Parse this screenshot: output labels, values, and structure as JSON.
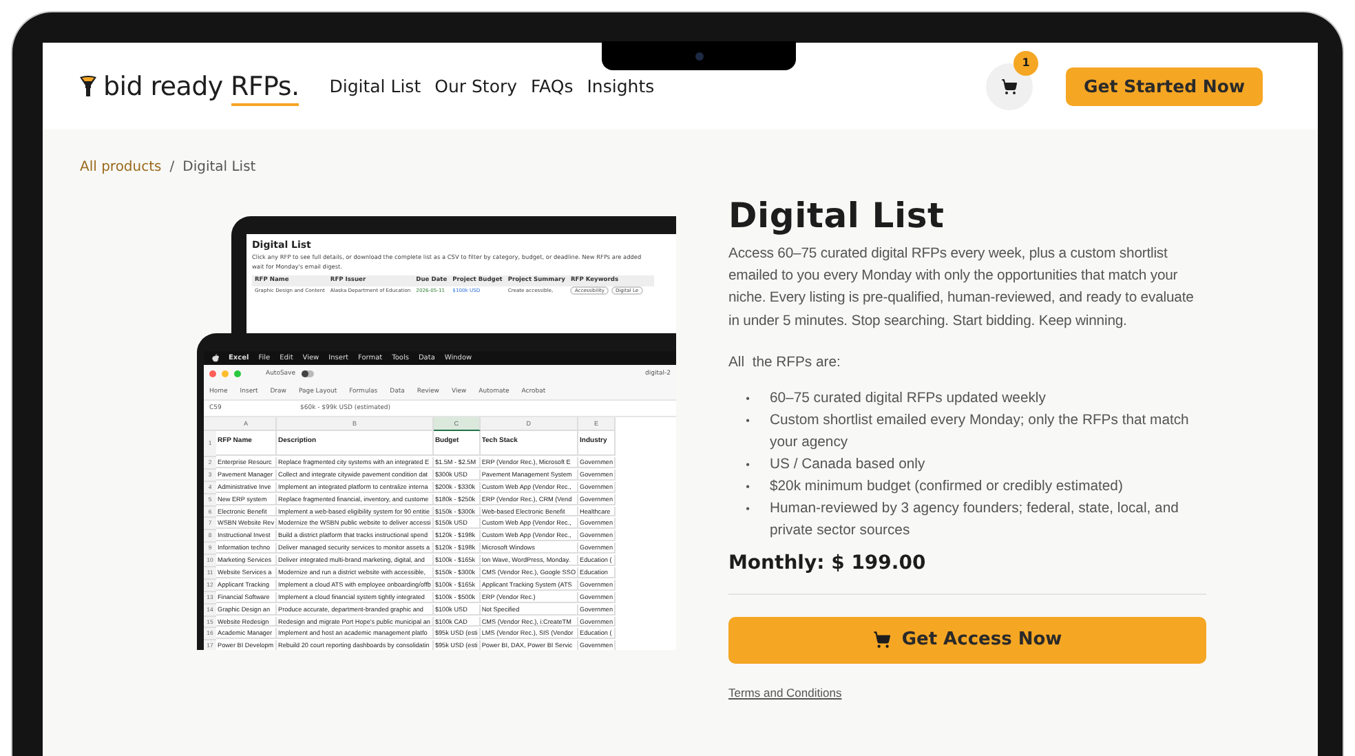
{
  "header": {
    "logo": {
      "text": "bid ready",
      "underlined": "RFPs."
    },
    "nav": [
      {
        "label": "Digital List"
      },
      {
        "label": "Our Story"
      },
      {
        "label": "FAQs"
      },
      {
        "label": "Insights"
      }
    ],
    "cart": {
      "count": "1"
    },
    "cta": "Get Started Now"
  },
  "breadcrumb": {
    "items": [
      {
        "label": "All products",
        "kind": "link"
      },
      {
        "label": "Digital List",
        "kind": "current"
      }
    ],
    "separator": "/"
  },
  "product_image": {
    "back_screen": {
      "title": "Digital List",
      "description": [
        "Click any RFP to see full details, or download the complete list as a CSV to filter by category, budget, or deadline. New RFPs are added",
        "wait for Monday's email digest."
      ],
      "columns": [
        "RFP Name",
        "RFP Issuer",
        "Due Date",
        "Project Budget",
        "Project Summary",
        "RFP Keywords"
      ],
      "row": [
        "Graphic Design and Content",
        "Alaska Department of Education",
        "2026-05-11",
        "$100k USD",
        "Create accessible,"
      ],
      "tags": [
        "Accessibility",
        "Digital Le"
      ]
    },
    "front_screen": {
      "menu": [
        "Excel",
        "File",
        "Edit",
        "View",
        "Insert",
        "Format",
        "Tools",
        "Data",
        "Window"
      ],
      "autosave": "AutoSave",
      "autosave_on": false,
      "file_name": "digital-2",
      "ribbon": [
        "Home",
        "Insert",
        "Draw",
        "Page Layout",
        "Formulas",
        "Data",
        "Review",
        "View",
        "Automate",
        "Acrobat"
      ],
      "cell_ref": "C59",
      "formula": "$60k - $99k USD (estimated)",
      "column_letters": [
        {
          "label": "A",
          "selected": false
        },
        {
          "label": "B",
          "selected": false
        },
        {
          "label": "C",
          "selected": true
        },
        {
          "label": "D",
          "selected": false
        },
        {
          "label": "E",
          "selected": false
        }
      ],
      "header_row": {
        "number": "1",
        "cells": [
          "RFP Name",
          "Description",
          "Budget",
          "Tech Stack",
          "Industry"
        ]
      },
      "rows": [
        {
          "number": "2",
          "cells": [
            "Enterprise Resourc",
            "Replace fragmented city systems with an integrated E",
            "$1.5M - $2.5M",
            "ERP (Vendor Rec.), Microsoft E",
            "Governmen"
          ]
        },
        {
          "number": "3",
          "cells": [
            "Pavement Manager",
            "Collect and integrate citywide pavement condition dat",
            "$300k USD",
            "Pavement Management System",
            "Governmen"
          ]
        },
        {
          "number": "4",
          "cells": [
            "Administrative Inve",
            "Implement an integrated platform to centralize interna",
            "$200k - $330k",
            "Custom Web App (Vendor Rec.,",
            "Governmen"
          ]
        },
        {
          "number": "5",
          "cells": [
            "New ERP system",
            "Replace fragmented financial, inventory, and custome",
            "$180k - $250k",
            "ERP (Vendor Rec.), CRM (Vend",
            "Governmen"
          ]
        },
        {
          "number": "6",
          "cells": [
            "Electronic Benefit",
            "Implement a web-based eligibility system for 90 entitie",
            "$150k - $300k",
            "Web-based Electronic Benefit",
            "Healthcare"
          ]
        },
        {
          "number": "7",
          "cells": [
            "WSBN Website Rev",
            "Modernize the WSBN public website to deliver accessi",
            "$150k USD",
            "Custom Web App (Vendor Rec.,",
            "Governmen"
          ]
        },
        {
          "number": "8",
          "cells": [
            "Instructional Invest",
            "Build a district platform that tracks instructional spend",
            "$120k - $198k",
            "Custom Web App (Vendor Rec.,",
            "Governmen"
          ]
        },
        {
          "number": "9",
          "cells": [
            "Information techno",
            "Deliver managed security services to monitor assets a",
            "$120k - $198k",
            "Microsoft Windows",
            "Governmen"
          ]
        },
        {
          "number": "10",
          "cells": [
            "Marketing Services",
            "Deliver integrated multi-brand marketing, digital, and",
            "$100k - $165k",
            "Ion Wave, WordPress, Monday.",
            "Education ("
          ]
        },
        {
          "number": "11",
          "cells": [
            "Website Services a",
            "Modernize and run a district website with accessible,",
            "$150k - $300k",
            "CMS (Vendor Rec.), Google SSO",
            "Education"
          ]
        },
        {
          "number": "12",
          "cells": [
            "Applicant Tracking",
            "Implement a cloud ATS with employee onboarding/offb",
            "$100k - $165k",
            "Applicant Tracking System (ATS",
            "Governmen"
          ]
        },
        {
          "number": "13",
          "cells": [
            "Financial Software",
            "Implement a cloud financial system tightly integrated",
            "$100k - $500k",
            "ERP (Vendor Rec.)",
            "Governmen"
          ]
        },
        {
          "number": "14",
          "cells": [
            "Graphic Design an",
            "Produce accurate, department-branded graphic and",
            "$100k USD",
            "Not Specified",
            "Governmen"
          ]
        },
        {
          "number": "15",
          "cells": [
            "Website Redesign",
            "Redesign and migrate Port Hope's public municipal an",
            "$100k CAD",
            "CMS (Vendor Rec.), i:CreateTM",
            "Governmen"
          ]
        },
        {
          "number": "16",
          "cells": [
            "Academic Manager",
            "Implement and host an academic management platfo",
            "$95k USD (esti",
            "LMS (Vendor Rec.), SIS (Vendor",
            "Education ("
          ]
        },
        {
          "number": "17",
          "cells": [
            "Power BI Developm",
            "Rebuild 20 court reporting dashboards by consolidatin",
            "$95k USD (esti",
            "Power BI, DAX, Power BI Servic",
            "Governmen"
          ]
        }
      ]
    }
  },
  "product": {
    "title": "Digital List",
    "description": "Access 60–75 curated digital RFPs every week, plus a custom shortlist emailed to you every Monday with only the opportunities that match your niche. Every listing is pre-qualified, human-reviewed, and ready to evaluate in under 5 minutes. Stop searching. Start bidding. Keep winning.",
    "intro": "All  the RFPs are:",
    "bullet": "•",
    "features": [
      "60–75 curated digital RFPs updated weekly",
      "Custom shortlist emailed every Monday; only the RFPs that match your agency",
      "US / Canada based only",
      "$20k minimum budget (confirmed or credibly estimated)",
      "Human-reviewed by 3 agency founders; federal, state, local, and private sector sources"
    ],
    "price": "Monthly: $ 199.00",
    "button": "Get Access Now",
    "terms": "Terms and Conditions"
  }
}
